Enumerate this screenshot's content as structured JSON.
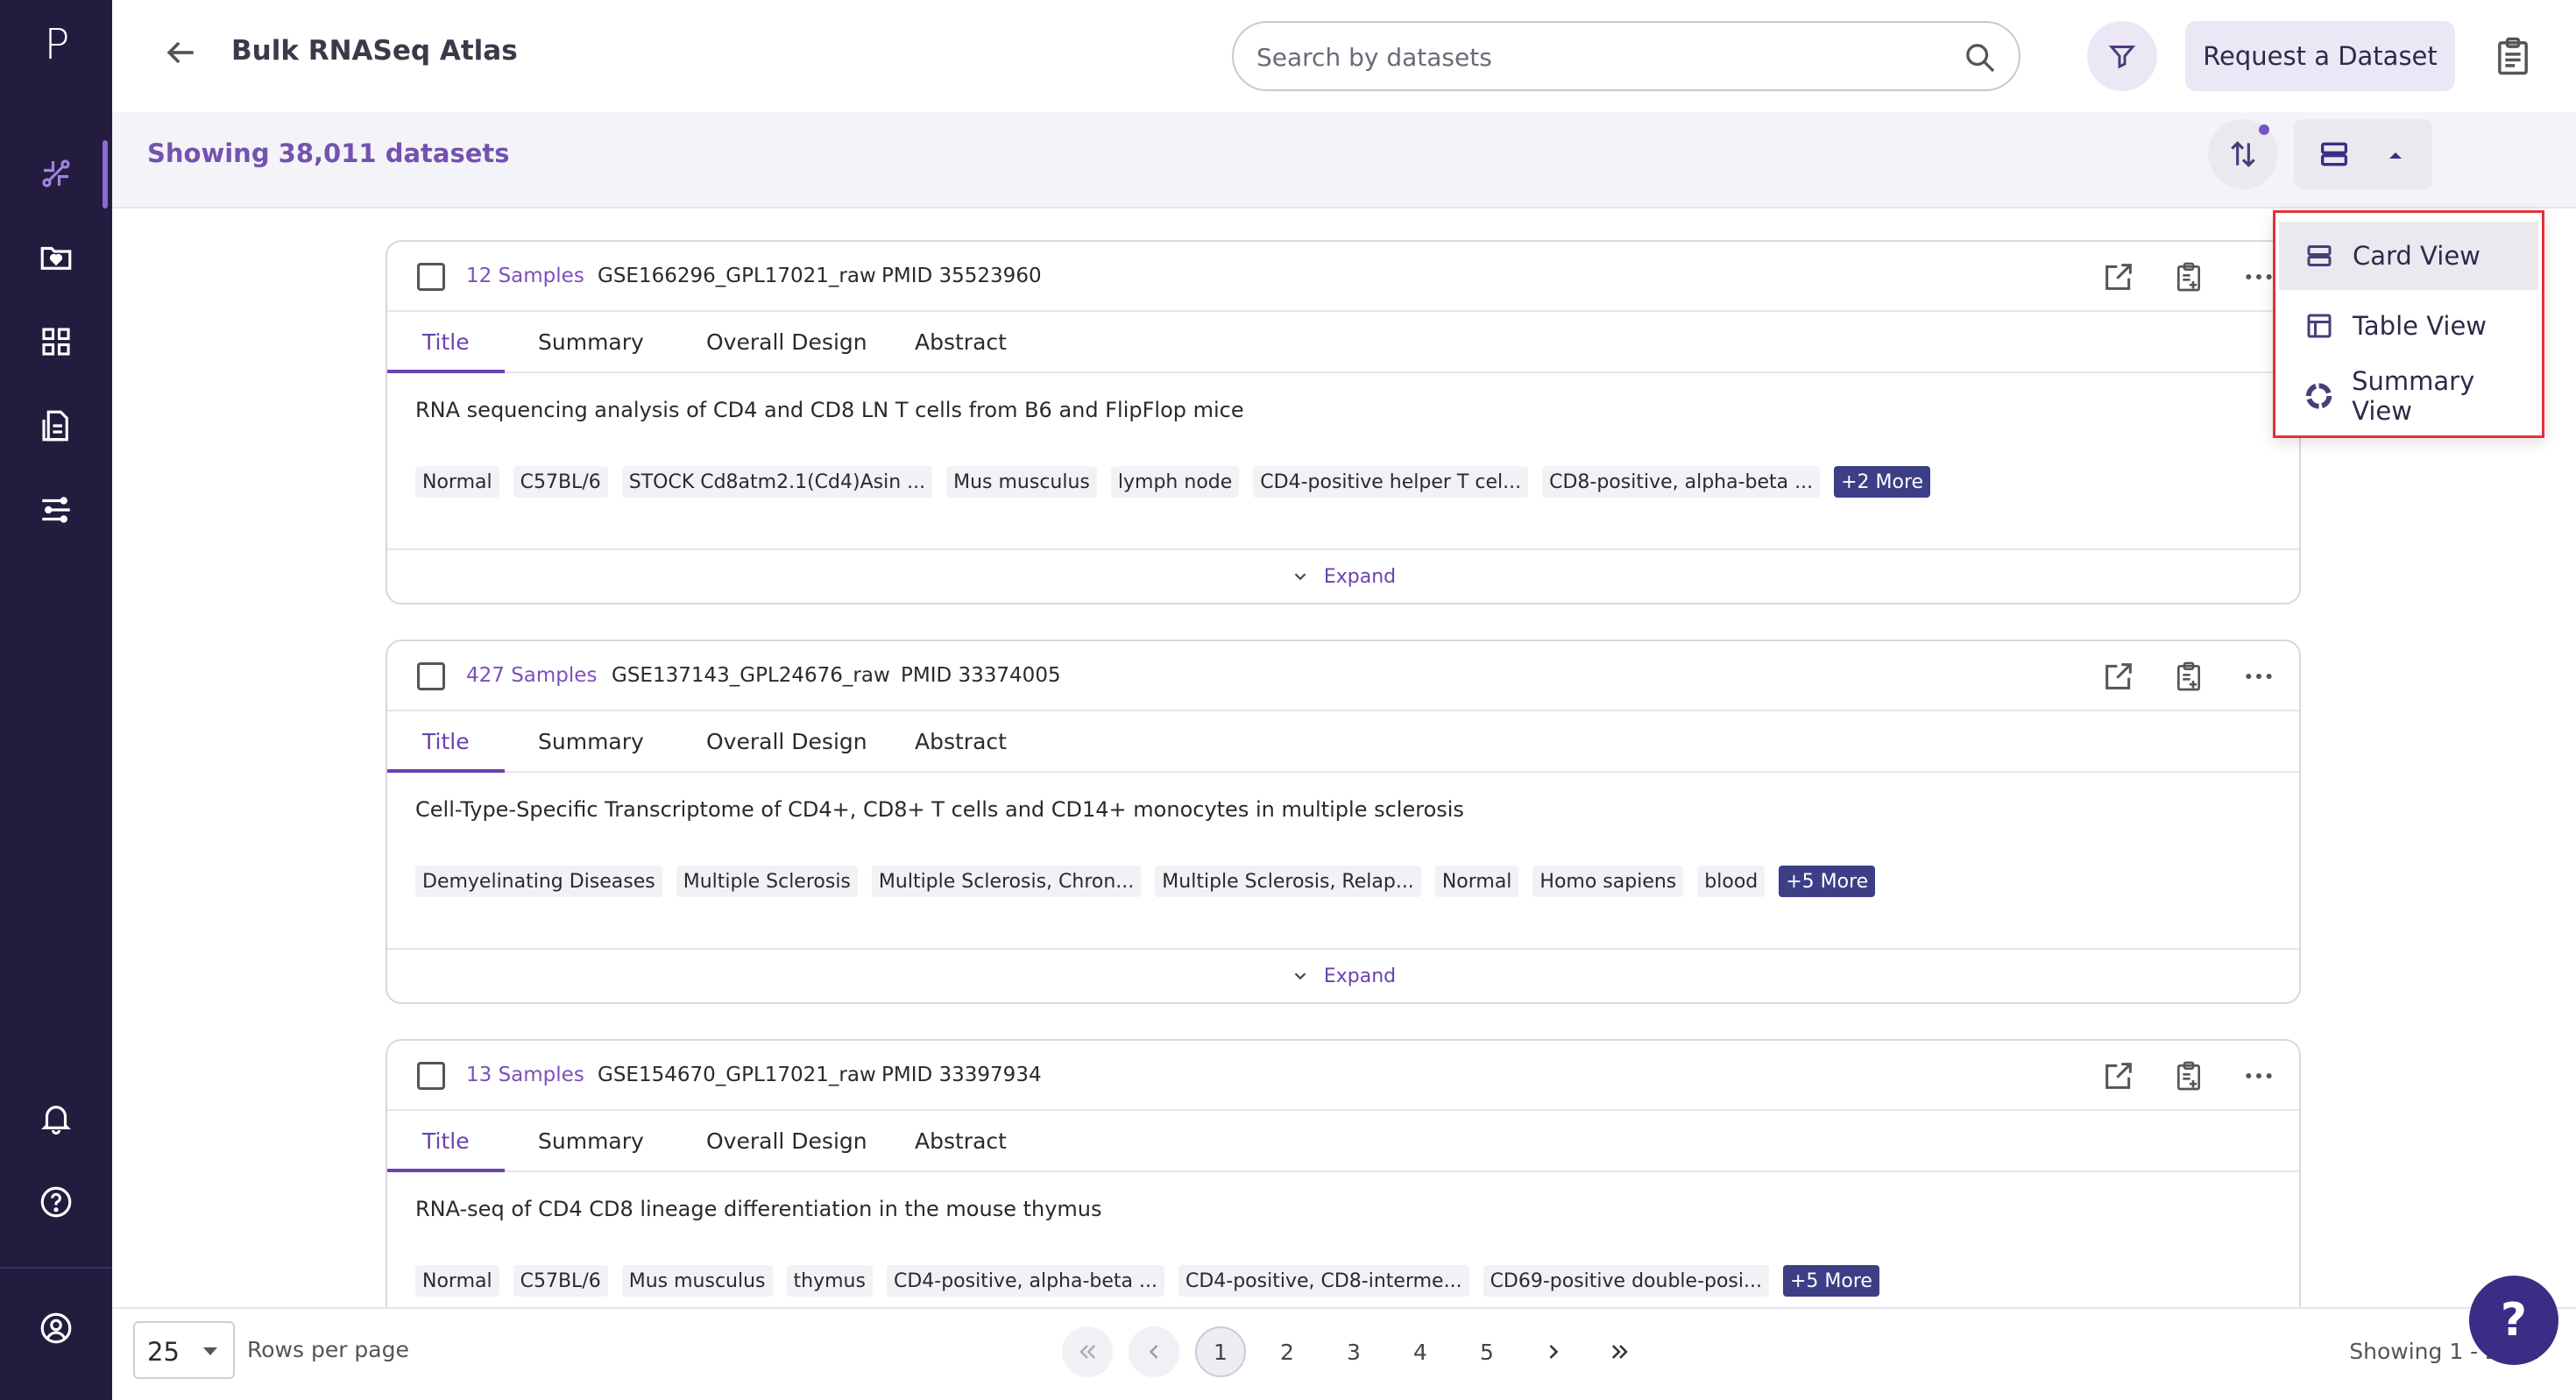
{
  "app": {
    "logo": "P",
    "page_title": "Bulk RNASeq Atlas"
  },
  "search": {
    "placeholder": "Search by datasets"
  },
  "header": {
    "request_label": "Request a Dataset"
  },
  "showing_text": "Showing 38,011 datasets",
  "tabs": [
    "Title",
    "Summary",
    "Overall Design",
    "Abstract"
  ],
  "expand_label": "Expand",
  "cards": [
    {
      "samples": "12 Samples",
      "gse": "GSE166296_GPL17021_raw",
      "pmid": "PMID 35523960",
      "title": "RNA sequencing analysis of CD4 and CD8 LN T cells from B6 and FlipFlop mice",
      "chips": [
        "Normal",
        "C57BL/6",
        "STOCK Cd8atm2.1(Cd4)Asin ...",
        "Mus musculus",
        "lymph node",
        "CD4-positive helper T cel...",
        "CD8-positive, alpha-beta ..."
      ],
      "more": "+2 More"
    },
    {
      "samples": "427 Samples",
      "gse": "GSE137143_GPL24676_raw",
      "pmid": "PMID 33374005",
      "title": "Cell-Type-Specific Transcriptome of CD4+, CD8+ T cells and CD14+ monocytes in multiple sclerosis",
      "chips": [
        "Demyelinating Diseases",
        "Multiple Sclerosis",
        "Multiple Sclerosis, Chron...",
        "Multiple Sclerosis, Relap...",
        "Normal",
        "Homo sapiens",
        "blood"
      ],
      "more": "+5 More"
    },
    {
      "samples": "13 Samples",
      "gse": "GSE154670_GPL17021_raw",
      "pmid": "PMID 33397934",
      "title": "RNA-seq of CD4 CD8 lineage differentiation in the mouse thymus",
      "chips": [
        "Normal",
        "C57BL/6",
        "Mus musculus",
        "thymus",
        "CD4-positive, alpha-beta ...",
        "CD4-positive, CD8-interme...",
        "CD69-positive double-posi..."
      ],
      "more": "+5 More"
    }
  ],
  "view_menu": {
    "items": [
      "Card View",
      "Table View",
      "Summary View"
    ],
    "selected": "Card View"
  },
  "pagination": {
    "rows_per_page": "25",
    "rows_label": "Rows per page",
    "pages": [
      "1",
      "2",
      "3",
      "4",
      "5"
    ],
    "current": "1",
    "status": "Showing 1 - 25 of"
  },
  "help_label": "?",
  "colors": {
    "sidebar": "#241c3f",
    "accent": "#7452b0",
    "chip_more": "#3c3f86",
    "highlight_border": "#e0323a"
  }
}
